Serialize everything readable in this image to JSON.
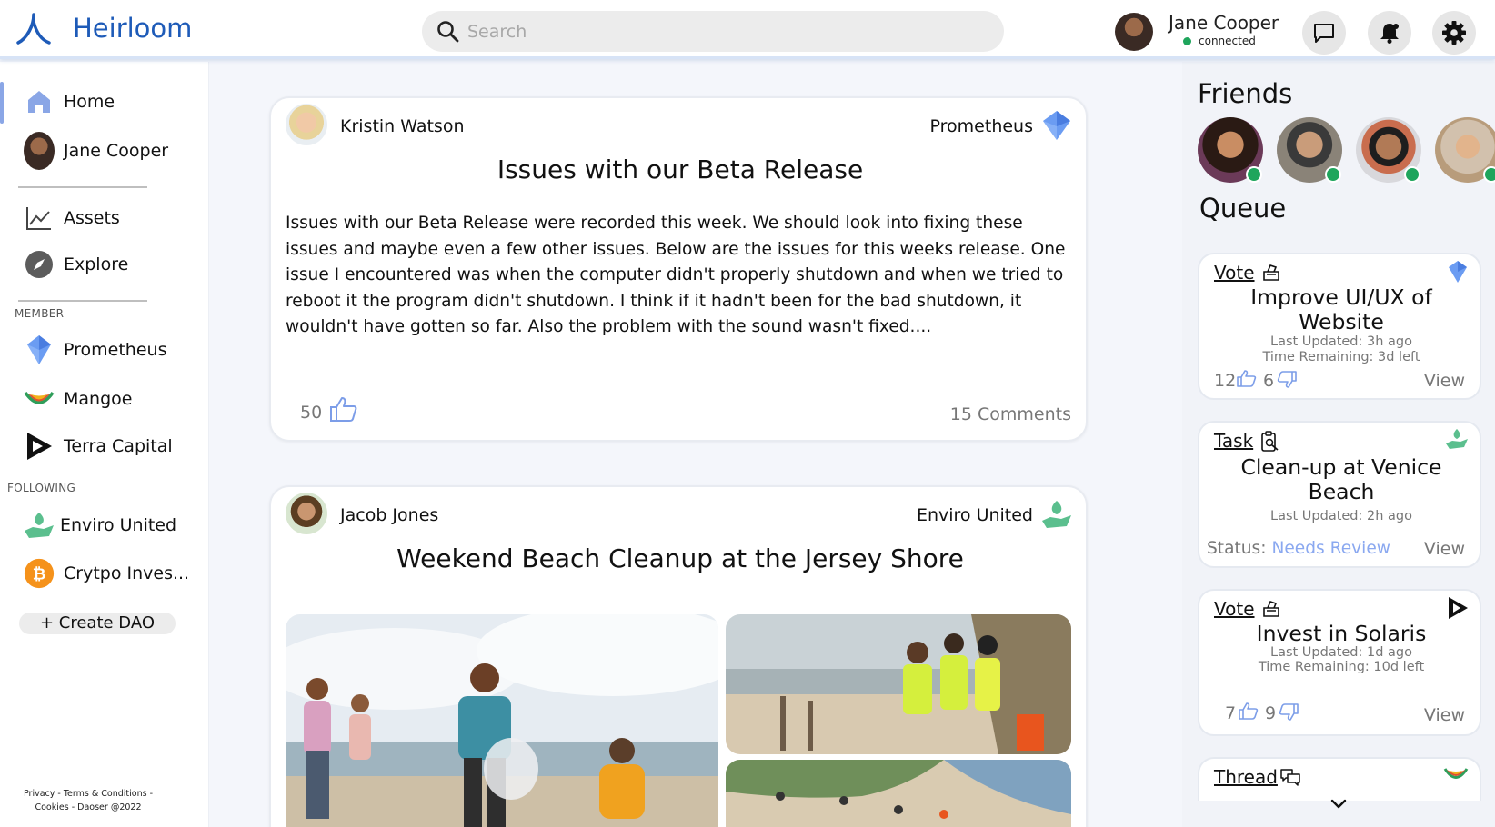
{
  "app": {
    "name": "Heirloom",
    "brand_color": "#1e5bb8"
  },
  "search": {
    "placeholder": "Search"
  },
  "user": {
    "name": "Jane Cooper",
    "status": "connected"
  },
  "topbar_icons": [
    "message-icon",
    "bell-icon",
    "gear-icon"
  ],
  "sidebar": {
    "main": [
      {
        "label": "Home",
        "icon": "home-icon",
        "active": true
      },
      {
        "label": "Jane Cooper",
        "icon": "avatar"
      }
    ],
    "tools": [
      {
        "label": "Assets",
        "icon": "chart-line-icon"
      },
      {
        "label": "Explore",
        "icon": "compass-icon"
      }
    ],
    "member_label": "MEMBER",
    "member": [
      {
        "label": "Prometheus",
        "icon": "prometheus-logo-icon"
      },
      {
        "label": "Mangoe",
        "icon": "mangoe-logo-icon"
      },
      {
        "label": "Terra Capital",
        "icon": "terra-capital-logo-icon"
      }
    ],
    "following_label": "FOLLOWING",
    "following": [
      {
        "label": "Enviro United",
        "icon": "enviro-united-logo-icon"
      },
      {
        "label": "Crytpo Inves...",
        "icon": "bitcoin-icon"
      }
    ],
    "create_dao": "+ Create DAO",
    "footer_line1": "Privacy - Terms & Conditions -",
    "footer_line2": "Cookies - Daoser @2022"
  },
  "feed": [
    {
      "author": "Kristin Watson",
      "dao": "Prometheus",
      "title": "Issues with our Beta Release",
      "body": "Issues with our Beta Release were recorded this week. We should look into fixing these issues and maybe even a few other issues. Below are the issues for this weeks release. One issue I encountered was when the computer didn't properly shutdown and when we tried to reboot it the program didn't shutdown. I think if it hadn't been for the bad shutdown, it wouldn't have gotten so far. Also the problem with the sound wasn't fixed....",
      "likes": "50",
      "comments": "15 Comments"
    },
    {
      "author": "Jacob Jones",
      "dao": "Enviro United",
      "title": "Weekend Beach Cleanup at the Jersey Shore"
    }
  ],
  "right": {
    "friends_title": "Friends",
    "queue_title": "Queue",
    "queue": [
      {
        "type": "Vote",
        "title": "Improve UI/UX of Website",
        "updated": "Last Updated: 3h ago",
        "remaining": "Time Remaining: 3d left",
        "up": "12",
        "down": "6",
        "view": "View"
      },
      {
        "type": "Task",
        "title": "Clean-up at Venice Beach",
        "updated": "Last Updated: 2h ago",
        "status_label": "Status:",
        "status_value": "Needs Review",
        "view": "View"
      },
      {
        "type": "Vote",
        "title": "Invest in Solaris",
        "updated": "Last Updated: 1d ago",
        "remaining": "Time Remaining: 10d left",
        "up": "7",
        "down": "9",
        "view": "View"
      },
      {
        "type": "Thread"
      }
    ]
  },
  "colors": {
    "accent": "#8aa6e6",
    "online": "#1fa55c",
    "needs_review": "#8aa8f0"
  }
}
